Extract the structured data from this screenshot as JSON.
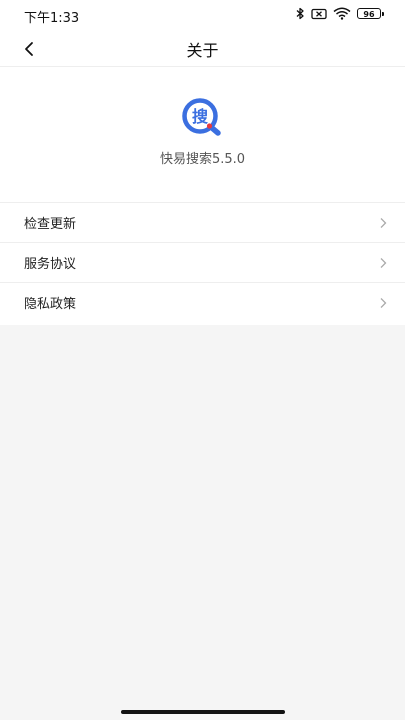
{
  "status_bar": {
    "time": "下午1:33",
    "battery": "96"
  },
  "header": {
    "title": "关于"
  },
  "app": {
    "logo_glyph": "搜",
    "name_version": "快易搜索5.5.0",
    "brand_color": "#3b6fe0",
    "accent_color": "#e8383d"
  },
  "menu": {
    "items": [
      {
        "label": "检查更新"
      },
      {
        "label": "服务协议"
      },
      {
        "label": "隐私政策"
      }
    ]
  }
}
